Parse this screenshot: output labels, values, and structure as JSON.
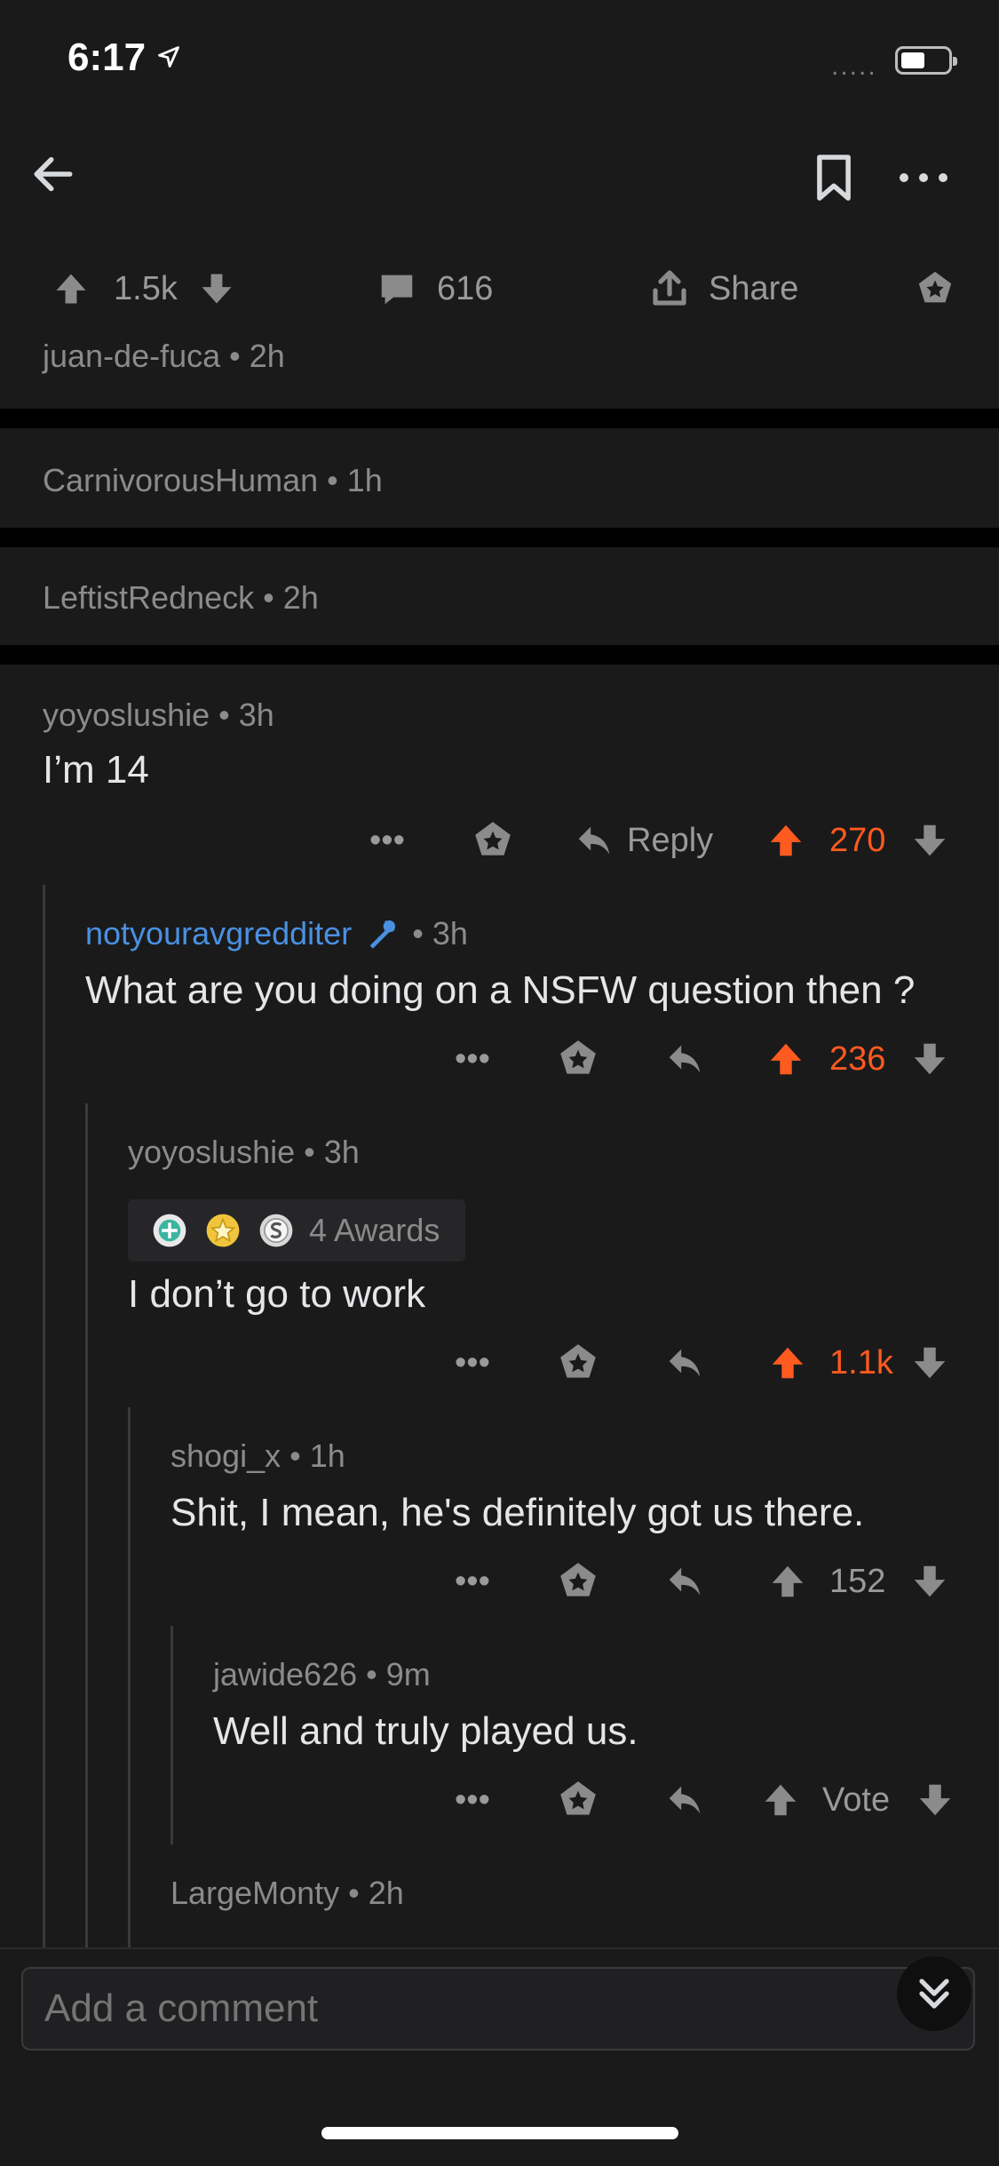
{
  "status_bar": {
    "time": "6:17",
    "signal": "....."
  },
  "post": {
    "upvotes": "1.5k",
    "comments": "616",
    "share_label": "Share",
    "op_meta": "juan-de-fuca • 2h"
  },
  "collapsed": [
    {
      "meta": "CarnivorousHuman • 1h"
    },
    {
      "meta": "LeftistRedneck • 2h"
    }
  ],
  "comments": [
    {
      "meta": "yoyoslushie • 3h",
      "text": "I’m 14",
      "reply_label": "Reply",
      "more": "•••",
      "score": "270",
      "voted": true
    },
    {
      "author": "notyouravgredditer",
      "time": "• 3h",
      "text": "What are you doing on a NSFW question then ?",
      "more": "•••",
      "score": "236",
      "voted": true
    },
    {
      "meta": "yoyoslushie • 3h",
      "awards_label": "4 Awards",
      "text": "I don’t go to work",
      "more": "•••",
      "score": "1.1k",
      "voted": true
    },
    {
      "meta": "shogi_x • 1h",
      "text": "Shit, I mean, he's definitely got us there.",
      "more": "•••",
      "score": "152",
      "voted": false
    },
    {
      "meta": "jawide626 • 9m",
      "text": "Well and truly played us.",
      "more": "•••",
      "score": "Vote",
      "voted": false
    },
    {
      "meta": "LargeMonty • 2h"
    }
  ],
  "composer": {
    "placeholder": "Add a comment"
  },
  "colors": {
    "accent": "#ff5a1f",
    "link": "#4a90e2",
    "background": "#1a1a1b"
  }
}
